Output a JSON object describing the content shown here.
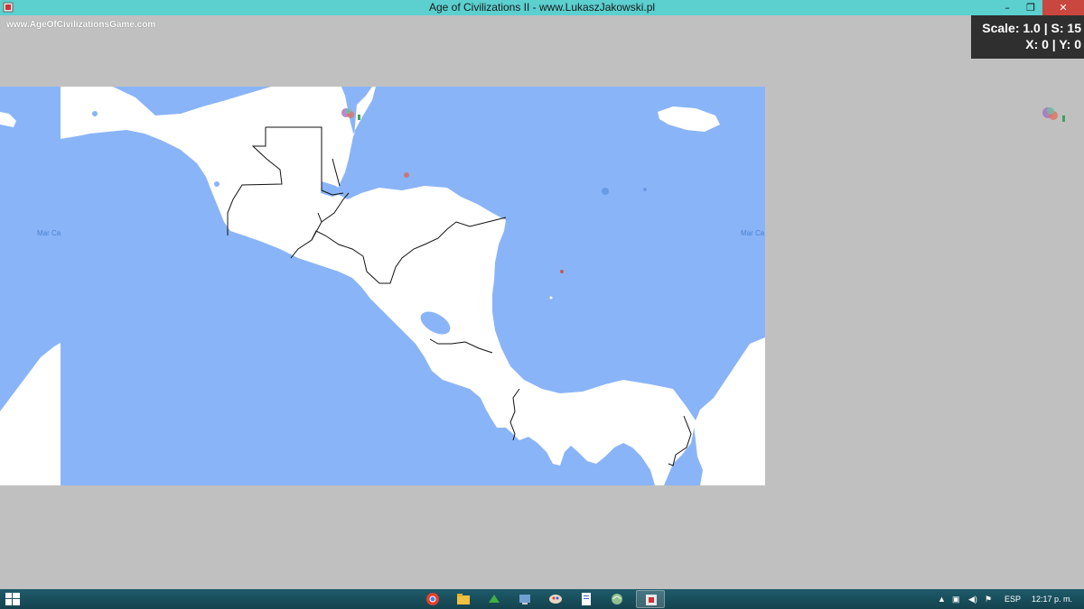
{
  "window": {
    "title": "Age of Civilizations II - www.LukaszJakowski.pl",
    "minimize_glyph": "–",
    "maximize_glyph": "❐",
    "close_glyph": "✕"
  },
  "game": {
    "website": "www.AgeOfCivilizationsGame.com",
    "scale_line": "Scale: 1.0 | S: 15",
    "coords_line": "X: 0 | Y: 0",
    "sea_label_left": "Mar Ca",
    "sea_label_right": "Mar Ca"
  },
  "colors": {
    "sea": "#8ab4f8",
    "land": "#ffffff",
    "background": "#c0c0c0",
    "titlebar": "#5ccfcf",
    "close": "#c9473e"
  },
  "taskbar": {
    "apps": [
      {
        "name": "chrome-icon"
      },
      {
        "name": "file-explorer-icon"
      },
      {
        "name": "game-launcher-icon"
      },
      {
        "name": "control-panel-icon"
      },
      {
        "name": "paint-icon"
      },
      {
        "name": "document-icon"
      },
      {
        "name": "network-icon"
      },
      {
        "name": "java-app-icon"
      }
    ],
    "language": "ESP",
    "time": "12:17 p. m."
  }
}
